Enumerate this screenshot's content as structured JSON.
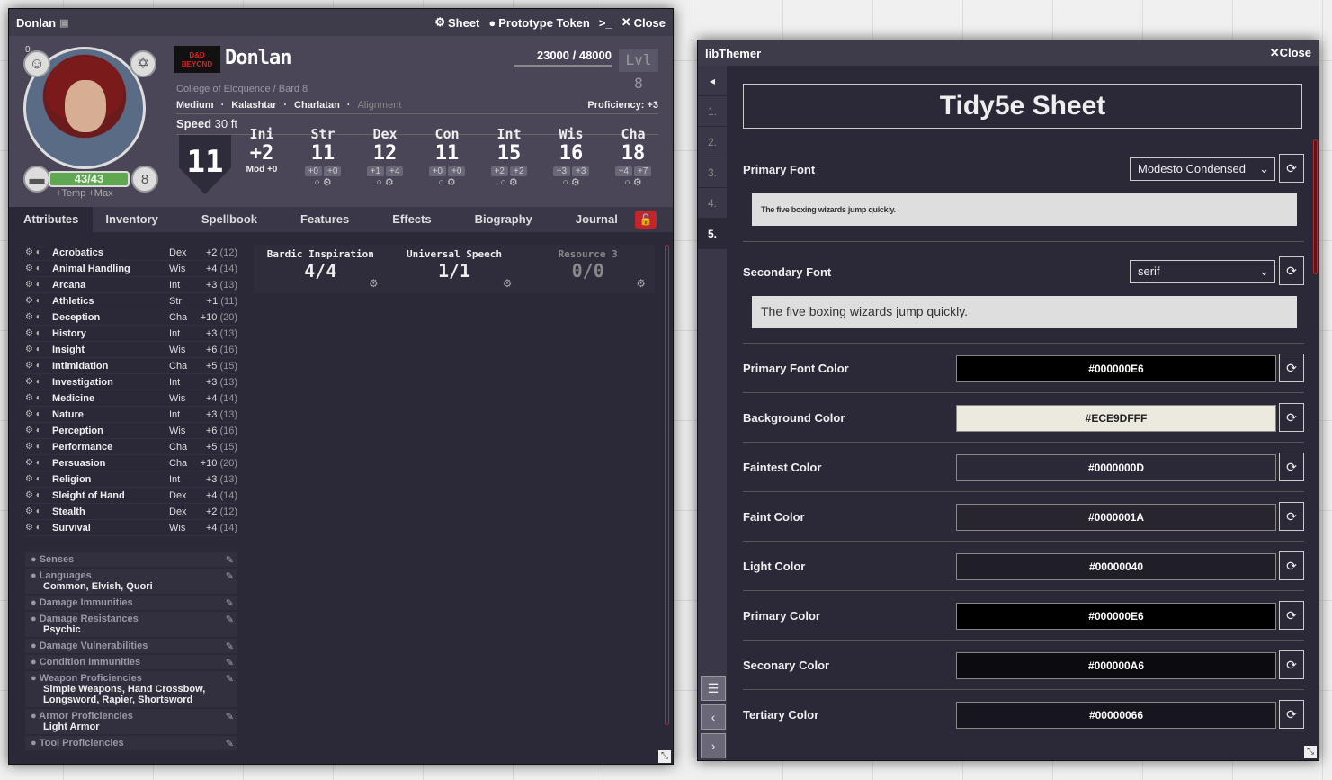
{
  "sheet": {
    "title": "Donlan",
    "header_buttons": {
      "sheet": "Sheet",
      "token": "Prototype Token",
      "close": "Close"
    },
    "name": "Donlan",
    "xp": "23000 / 48000",
    "level": "Lvl 8",
    "class_line": "College of Eloquence / Bard 8",
    "meta": {
      "size": "Medium",
      "race": "Kalashtar",
      "background": "Charlatan",
      "alignment": "Alignment",
      "proficiency": "Proficiency: +3"
    },
    "speed_label": "Speed",
    "speed_value": "30 ft",
    "ac": "11",
    "init": {
      "label": "Ini",
      "value": "+2",
      "mod": "Mod +0"
    },
    "hp": "43/43",
    "hp_sub": "+Temp  +Max",
    "inspiration": "0",
    "hit_dice": "8",
    "dndb_logo": "D&D BEYOND",
    "abilities": [
      {
        "label": "Str",
        "score": "11",
        "mod": "+0",
        "save": "+0"
      },
      {
        "label": "Dex",
        "score": "12",
        "mod": "+1",
        "save": "+4"
      },
      {
        "label": "Con",
        "score": "11",
        "mod": "+0",
        "save": "+0"
      },
      {
        "label": "Int",
        "score": "15",
        "mod": "+2",
        "save": "+2"
      },
      {
        "label": "Wis",
        "score": "16",
        "mod": "+3",
        "save": "+3"
      },
      {
        "label": "Cha",
        "score": "18",
        "mod": "+4",
        "save": "+7"
      }
    ],
    "tabs": [
      "Attributes",
      "Inventory",
      "Spellbook",
      "Features",
      "Effects",
      "Biography",
      "Journal"
    ],
    "skills": [
      {
        "name": "Acrobatics",
        "ab": "Dex",
        "mod": "+2",
        "pass": "(12)"
      },
      {
        "name": "Animal Handling",
        "ab": "Wis",
        "mod": "+4",
        "pass": "(14)"
      },
      {
        "name": "Arcana",
        "ab": "Int",
        "mod": "+3",
        "pass": "(13)"
      },
      {
        "name": "Athletics",
        "ab": "Str",
        "mod": "+1",
        "pass": "(11)"
      },
      {
        "name": "Deception",
        "ab": "Cha",
        "mod": "+10",
        "pass": "(20)"
      },
      {
        "name": "History",
        "ab": "Int",
        "mod": "+3",
        "pass": "(13)"
      },
      {
        "name": "Insight",
        "ab": "Wis",
        "mod": "+6",
        "pass": "(16)"
      },
      {
        "name": "Intimidation",
        "ab": "Cha",
        "mod": "+5",
        "pass": "(15)"
      },
      {
        "name": "Investigation",
        "ab": "Int",
        "mod": "+3",
        "pass": "(13)"
      },
      {
        "name": "Medicine",
        "ab": "Wis",
        "mod": "+4",
        "pass": "(14)"
      },
      {
        "name": "Nature",
        "ab": "Int",
        "mod": "+3",
        "pass": "(13)"
      },
      {
        "name": "Perception",
        "ab": "Wis",
        "mod": "+6",
        "pass": "(16)"
      },
      {
        "name": "Performance",
        "ab": "Cha",
        "mod": "+5",
        "pass": "(15)"
      },
      {
        "name": "Persuasion",
        "ab": "Cha",
        "mod": "+10",
        "pass": "(20)"
      },
      {
        "name": "Religion",
        "ab": "Int",
        "mod": "+3",
        "pass": "(13)"
      },
      {
        "name": "Sleight of Hand",
        "ab": "Dex",
        "mod": "+4",
        "pass": "(14)"
      },
      {
        "name": "Stealth",
        "ab": "Dex",
        "mod": "+2",
        "pass": "(12)"
      },
      {
        "name": "Survival",
        "ab": "Wis",
        "mod": "+4",
        "pass": "(14)"
      }
    ],
    "traits": [
      {
        "title": "Senses",
        "value": ""
      },
      {
        "title": "Languages",
        "value": "Common, Elvish, Quori"
      },
      {
        "title": "Damage Immunities",
        "value": ""
      },
      {
        "title": "Damage Resistances",
        "value": "Psychic"
      },
      {
        "title": "Damage Vulnerabilities",
        "value": ""
      },
      {
        "title": "Condition Immunities",
        "value": ""
      },
      {
        "title": "Weapon Proficiencies",
        "value": "Simple Weapons, Hand Crossbow, Longsword, Rapier, Shortsword"
      },
      {
        "title": "Armor Proficiencies",
        "value": "Light Armor"
      },
      {
        "title": "Tool Proficiencies",
        "value": ""
      }
    ],
    "resources": [
      {
        "title": "Bardic Inspiration",
        "value": "4/4"
      },
      {
        "title": "Universal Speech",
        "value": "1/1"
      },
      {
        "title": "Resource 3",
        "value": "0/0"
      }
    ]
  },
  "themer": {
    "title": "libThemer",
    "close": "Close",
    "heading": "Tidy5e Sheet",
    "nav": [
      "1.",
      "2.",
      "3.",
      "4.",
      "5."
    ],
    "primary_font": {
      "label": "Primary Font",
      "value": "Modesto Condensed",
      "preview": "The five boxing wizards jump quickly."
    },
    "secondary_font": {
      "label": "Secondary Font",
      "value": "serif",
      "preview": "The five boxing wizards jump quickly."
    },
    "colors": [
      {
        "label": "Primary Font Color",
        "value": "#000000E6",
        "bg": "#000000",
        "fg": "#ffffff"
      },
      {
        "label": "Background Color",
        "value": "#ECE9DFFF",
        "bg": "#ECE9DF",
        "fg": "#222222"
      },
      {
        "label": "Faintest Color",
        "value": "#0000000D",
        "bg": "#2b2838",
        "fg": "#ffffff"
      },
      {
        "label": "Faint Color",
        "value": "#0000001A",
        "bg": "#28252f",
        "fg": "#ffffff"
      },
      {
        "label": "Light Color",
        "value": "#00000040",
        "bg": "#201e26",
        "fg": "#ffffff"
      },
      {
        "label": "Primary Color",
        "value": "#000000E6",
        "bg": "#000000",
        "fg": "#ffffff"
      },
      {
        "label": "Seconary Color",
        "value": "#000000A6",
        "bg": "#0c0b10",
        "fg": "#ffffff"
      },
      {
        "label": "Tertiary Color",
        "value": "#00000066",
        "bg": "#17151d",
        "fg": "#ffffff"
      }
    ]
  }
}
